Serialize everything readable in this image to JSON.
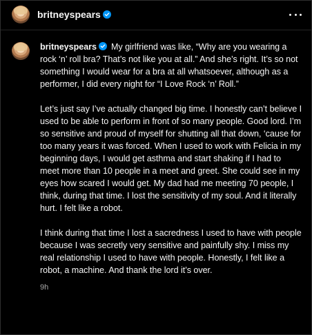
{
  "header": {
    "username": "britneyspears",
    "more_icon": "more-horizontal-icon"
  },
  "post": {
    "username": "britneyspears",
    "paragraphs": [
      "My girlfriend was like, “Why are you wearing a rock ‘n’ roll bra? That’s not like you at all.” And she’s right. It’s so not something I would wear for a bra at all whatsoever, although as a performer, I did every night for “I Love Rock ‘n’ Roll.”",
      "Let’s just say I’ve actually changed big time. I honestly can’t believe I used to be able to perform in front of so many people. Good lord. I’m so sensitive and proud of myself for shutting all that down, ‘cause for too many years it was forced. When I used to work with Felicia in my beginning days, I would get asthma and start shaking if I had to meet more than 10 people in a meet and greet. She could see in my eyes how scared I would get. My dad had me meeting 70 people, I think, during that time. I lost the sensitivity of my soul. And it literally hurt. I felt like a robot.",
      "I think during that time I lost a sacredness I used to have with people because I was secretly very sensitive and painfully shy. I miss my real relationship I used to have with people. Honestly, I felt like a robot, a machine. And thank the lord it’s over."
    ],
    "timestamp": "9h"
  },
  "colors": {
    "background": "#000000",
    "text": "#f5f5f5",
    "muted": "#a8a8a8",
    "verified": "#0095f6",
    "border": "#262626"
  }
}
